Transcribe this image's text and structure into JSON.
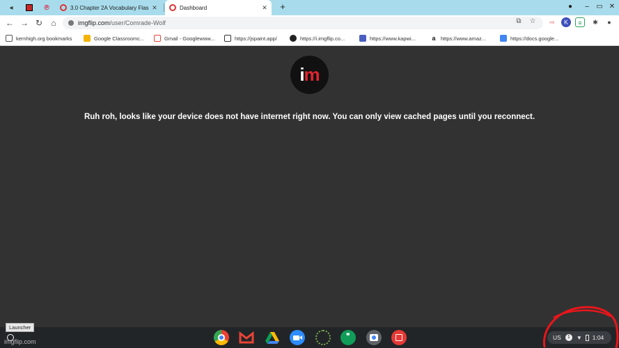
{
  "tabs": [
    {
      "title": "3.0 Chapter 2A Vocabulary Flas",
      "active": false
    },
    {
      "title": "Dashboard",
      "active": true
    }
  ],
  "toolbar": {
    "url_host": "imgflip.com",
    "url_path": "/user/Comrade-Wolf"
  },
  "bookmarks": [
    {
      "label": "kernhigh.org bookmarks",
      "color": "#555555"
    },
    {
      "label": "Google Classroomc...",
      "color": "#f4b400"
    },
    {
      "label": "Gmail - Googlewww...",
      "color": "#ea4335"
    },
    {
      "label": "https://jspaint.app/",
      "color": "#333333"
    },
    {
      "label": "https://i.imgflip.co...",
      "color": "#222222"
    },
    {
      "label": "https://www.kapwi...",
      "color": "#4a5fc1"
    },
    {
      "label": "https://www.amaz...",
      "color": "#111111"
    },
    {
      "label": "https://docs.google...",
      "color": "#4285f4"
    }
  ],
  "content": {
    "logo_text_i": "i",
    "logo_text_m": "m",
    "offline_message": "Ruh roh, looks like your device does not have internet right now. You can only view cached pages until you reconnect."
  },
  "shelf": {
    "launcher_tooltip": "Launcher",
    "watermark": "imgflip.com",
    "apps": [
      {
        "name": "chrome",
        "color": "#4285f4"
      },
      {
        "name": "gmail",
        "color": "#ea4335"
      },
      {
        "name": "drive",
        "color": "#0f9d58"
      },
      {
        "name": "zoom",
        "color": "#2d8cff"
      },
      {
        "name": "loading",
        "color": "#5e7a3a"
      },
      {
        "name": "hangouts",
        "color": "#0f9d58"
      },
      {
        "name": "camera",
        "color": "#c0c0c0"
      },
      {
        "name": "gallery",
        "color": "#e53935"
      }
    ],
    "tray": {
      "locale": "US",
      "notification_count": "1",
      "time": "1:04"
    }
  },
  "colors": {
    "tabstrip": "#a8dcec",
    "page_bg": "#323232",
    "annotation": "#e8161b"
  }
}
